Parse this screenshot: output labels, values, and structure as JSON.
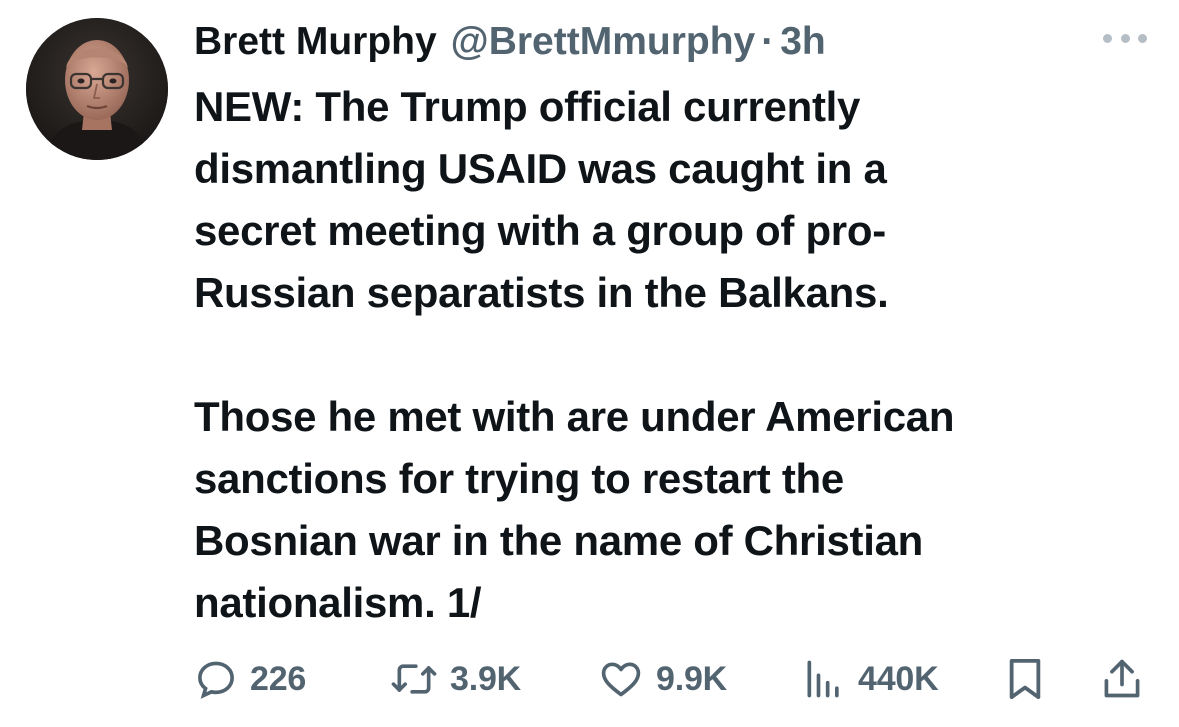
{
  "tweet": {
    "author": {
      "display_name": "Brett Murphy",
      "handle": "@BrettMmurphy",
      "separator": "·",
      "time": "3h",
      "avatar_icon": "profile-photo"
    },
    "text": {
      "paragraph_1": "NEW: The Trump official currently\ndismantling USAID was caught in a\nsecret meeting with a group of pro-\nRussian separatists in the Balkans.",
      "paragraph_2": "Those he met with are under American\nsanctions for trying to restart the\nBosnian war in the name of Christian\nnationalism. 1/"
    },
    "more_icon": "ellipsis-icon",
    "actions": {
      "replies": {
        "icon": "reply-icon",
        "count": "226"
      },
      "reposts": {
        "icon": "repost-icon",
        "count": "3.9K"
      },
      "likes": {
        "icon": "heart-icon",
        "count": "9.9K"
      },
      "views": {
        "icon": "views-icon",
        "count": "440K"
      },
      "bookmark": {
        "icon": "bookmark-icon"
      },
      "share": {
        "icon": "share-icon"
      }
    },
    "colors": {
      "text_primary": "#0f1419",
      "text_secondary": "#536471",
      "background": "#ffffff"
    }
  }
}
